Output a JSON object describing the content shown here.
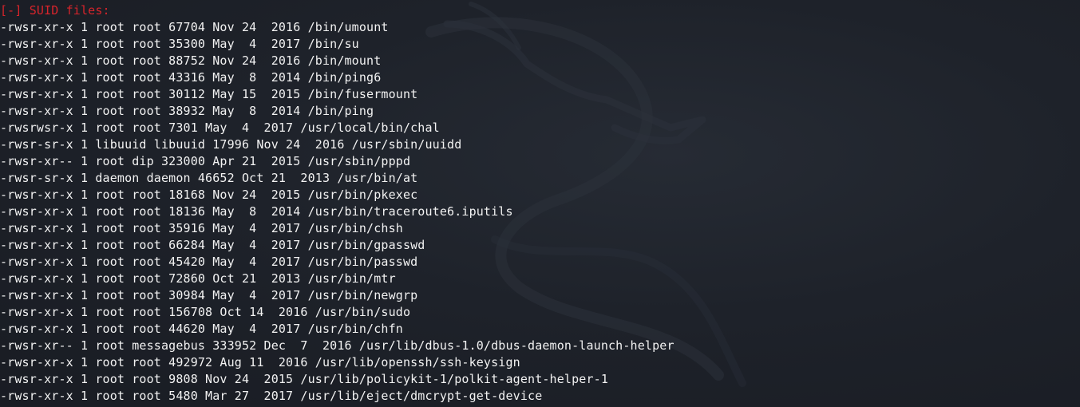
{
  "terminal": {
    "header": "[-] SUID files:",
    "lines": [
      "-rwsr-xr-x 1 root root 67704 Nov 24  2016 /bin/umount",
      "-rwsr-xr-x 1 root root 35300 May  4  2017 /bin/su",
      "-rwsr-xr-x 1 root root 88752 Nov 24  2016 /bin/mount",
      "-rwsr-xr-x 1 root root 43316 May  8  2014 /bin/ping6",
      "-rwsr-xr-x 1 root root 30112 May 15  2015 /bin/fusermount",
      "-rwsr-xr-x 1 root root 38932 May  8  2014 /bin/ping",
      "-rwsrwsr-x 1 root root 7301 May  4  2017 /usr/local/bin/chal",
      "-rwsr-sr-x 1 libuuid libuuid 17996 Nov 24  2016 /usr/sbin/uuidd",
      "-rwsr-xr-- 1 root dip 323000 Apr 21  2015 /usr/sbin/pppd",
      "-rwsr-sr-x 1 daemon daemon 46652 Oct 21  2013 /usr/bin/at",
      "-rwsr-xr-x 1 root root 18168 Nov 24  2015 /usr/bin/pkexec",
      "-rwsr-xr-x 1 root root 18136 May  8  2014 /usr/bin/traceroute6.iputils",
      "-rwsr-xr-x 1 root root 35916 May  4  2017 /usr/bin/chsh",
      "-rwsr-xr-x 1 root root 66284 May  4  2017 /usr/bin/gpasswd",
      "-rwsr-xr-x 1 root root 45420 May  4  2017 /usr/bin/passwd",
      "-rwsr-xr-x 1 root root 72860 Oct 21  2013 /usr/bin/mtr",
      "-rwsr-xr-x 1 root root 30984 May  4  2017 /usr/bin/newgrp",
      "-rwsr-xr-x 1 root root 156708 Oct 14  2016 /usr/bin/sudo",
      "-rwsr-xr-x 1 root root 44620 May  4  2017 /usr/bin/chfn",
      "-rwsr-xr-- 1 root messagebus 333952 Dec  7  2016 /usr/lib/dbus-1.0/dbus-daemon-launch-helper",
      "-rwsr-xr-x 1 root root 492972 Aug 11  2016 /usr/lib/openssh/ssh-keysign",
      "-rwsr-xr-x 1 root root 9808 Nov 24  2015 /usr/lib/policykit-1/polkit-agent-helper-1",
      "-rwsr-xr-x 1 root root 5480 Mar 27  2017 /usr/lib/eject/dmcrypt-get-device"
    ]
  },
  "colors": {
    "background": "#1b1f27",
    "text": "#f2f2f2",
    "header": "#d7242b"
  },
  "watermark_icon": "kali-dragon-icon"
}
